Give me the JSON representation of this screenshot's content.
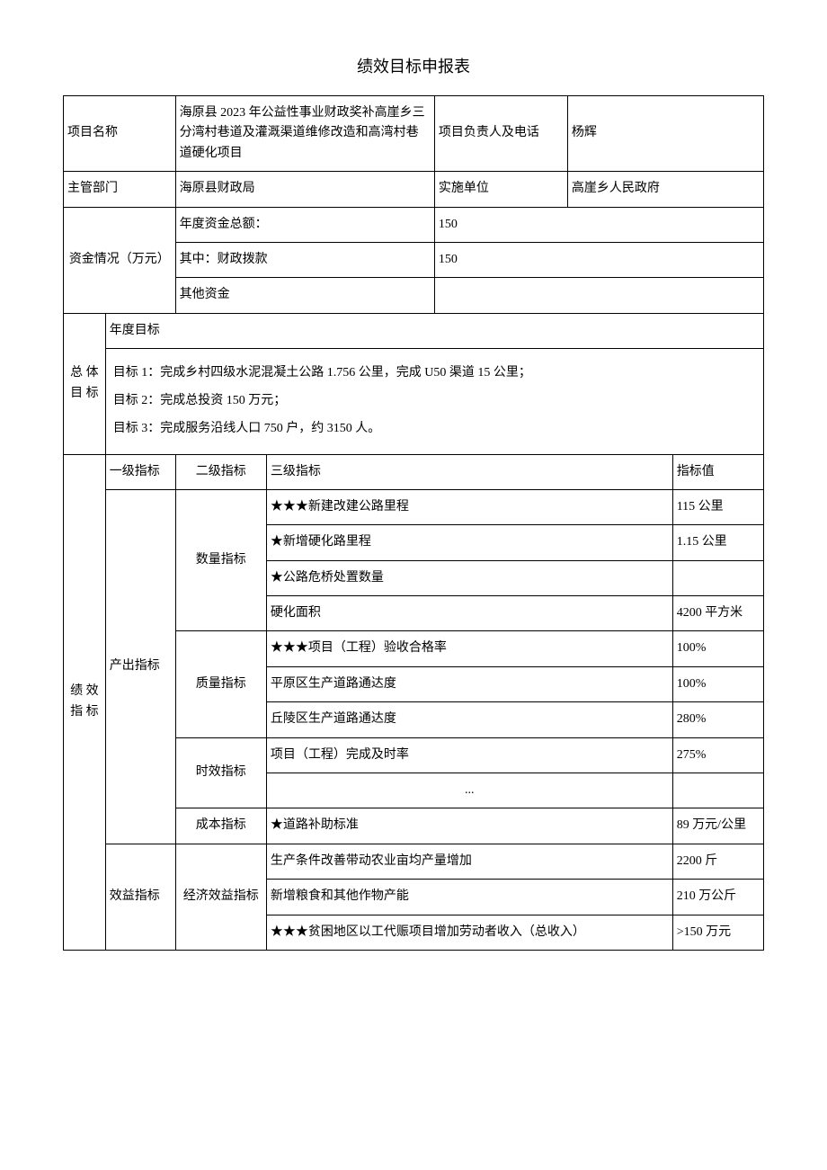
{
  "title": "绩效目标申报表",
  "header": {
    "project_name_label": "项目名称",
    "project_name_value": "海原县 2023 年公益性事业财政奖补高崖乡三分湾村巷道及灌溉渠道维修改造和高湾村巷道硬化项目",
    "project_owner_label": "项目负责人及电话",
    "project_owner_value": "杨辉",
    "department_label": "主管部门",
    "department_value": "海原县财政局",
    "implement_unit_label": "实施单位",
    "implement_unit_value": "高崖乡人民政府"
  },
  "funds": {
    "section_label": "资金情况（万元）",
    "total_label": "年度资金总额：",
    "total_value": "150",
    "fiscal_label": "其中：财政拨款",
    "fiscal_value": "150",
    "other_label": "其他资金",
    "other_value": ""
  },
  "overall": {
    "section_label": "总 体目 标",
    "annual_label": "年度目标",
    "goal1": "目标 1：完成乡村四级水泥混凝土公路 1.756 公里，完成 U50 渠道 15 公里；",
    "goal2": "目标 2：完成总投资 150 万元；",
    "goal3": "目标 3：完成服务沿线人口 750 户，约 3150 人。"
  },
  "indicators": {
    "section_label": "绩 效指 标",
    "col_level1": "一级指标",
    "col_level2": "二级指标",
    "col_level3": "三级指标",
    "col_value": "指标值",
    "output_label": "产出指标",
    "quantity_label": "数量指标",
    "quality_label": "质量指标",
    "time_label": "时效指标",
    "cost_label": "成本指标",
    "benefit_label": "效益指标",
    "economic_label": "经济效益指标",
    "rows": {
      "r1": {
        "name": "★★★新建改建公路里程",
        "value": "115 公里"
      },
      "r2": {
        "name": "★新增硬化路里程",
        "value": "1.15 公里"
      },
      "r3": {
        "name": "★公路危桥处置数量",
        "value": ""
      },
      "r4": {
        "name": "硬化面积",
        "value": "4200 平方米"
      },
      "r5": {
        "name": "★★★项目（工程）验收合格率",
        "value": "100%"
      },
      "r6": {
        "name": "平原区生产道路通达度",
        "value": "100%"
      },
      "r7": {
        "name": "丘陵区生产道路通达度",
        "value": "280%"
      },
      "r8": {
        "name": "项目（工程）完成及时率",
        "value": "275%"
      },
      "r9": {
        "name": "...",
        "value": ""
      },
      "r10": {
        "name": "★道路补助标准",
        "value": "89 万元/公里"
      },
      "r11": {
        "name": "生产条件改善带动农业亩均产量增加",
        "value": "2200 斤"
      },
      "r12": {
        "name": "新增粮食和其他作物产能",
        "value": "210 万公斤"
      },
      "r13": {
        "name": "★★★贫困地区以工代赈项目增加劳动者收入（总收入）",
        "value": ">150 万元"
      }
    }
  }
}
